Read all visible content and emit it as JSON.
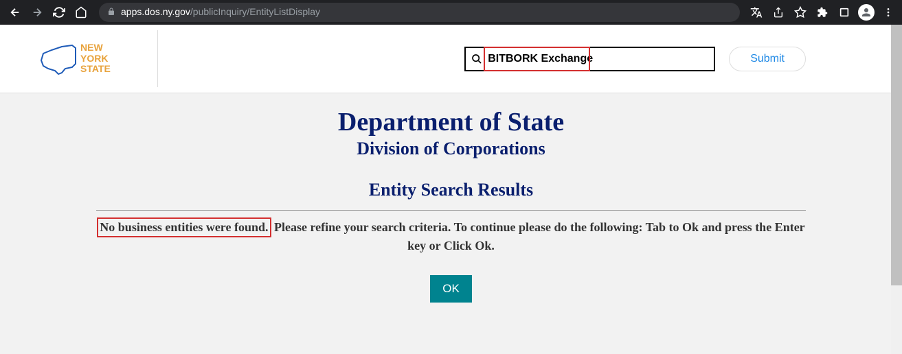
{
  "browser": {
    "url_host": "apps.dos.ny.gov",
    "url_path": "/publicInquiry/EntityListDisplay"
  },
  "header": {
    "logo_text_line1": "NEW",
    "logo_text_line2": "YORK",
    "logo_text_line3": "STATE",
    "search_value": "BITBORK Exchange",
    "submit_label": "Submit"
  },
  "content": {
    "main_title": "Department of State",
    "subtitle": "Division of Corporations",
    "section_title": "Entity Search Results",
    "no_results_text": "No business entities were found.",
    "refine_text": " Please refine your search criteria. To continue please do the following: Tab to Ok and press the Enter key or Click Ok.",
    "ok_label": "OK"
  }
}
